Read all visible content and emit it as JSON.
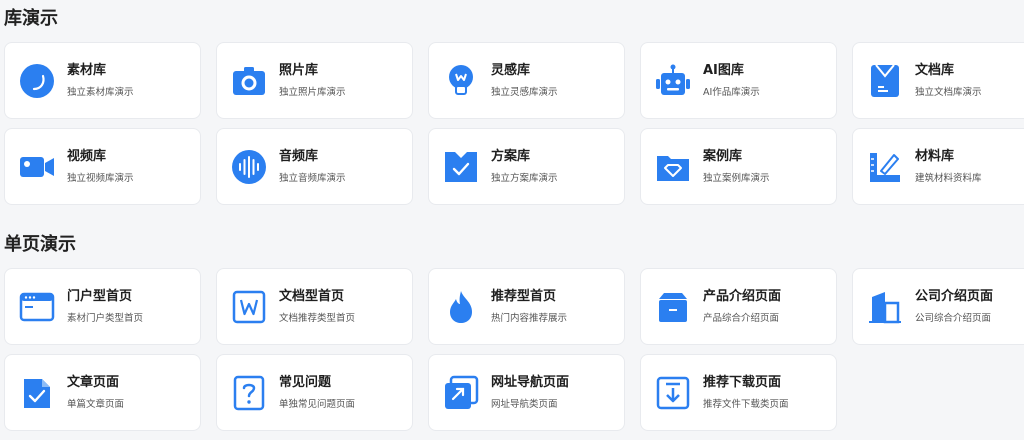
{
  "accent": "#2b7ff0",
  "sections": [
    {
      "title": "库演示",
      "cards": [
        {
          "name": "素材库",
          "desc": "独立素材库演示",
          "icon": "material-library-icon"
        },
        {
          "name": "照片库",
          "desc": "独立照片库演示",
          "icon": "camera-icon"
        },
        {
          "name": "灵感库",
          "desc": "独立灵感库演示",
          "icon": "lightbulb-icon"
        },
        {
          "name": "AI图库",
          "desc": "AI作品库演示",
          "icon": "robot-icon"
        },
        {
          "name": "文档库",
          "desc": "独立文档库演示",
          "icon": "document-icon"
        },
        {
          "name": "视频库",
          "desc": "独立视频库演示",
          "icon": "video-camera-icon"
        },
        {
          "name": "音频库",
          "desc": "独立音频库演示",
          "icon": "audio-wave-icon"
        },
        {
          "name": "方案库",
          "desc": "独立方案库演示",
          "icon": "checked-folder-icon"
        },
        {
          "name": "案例库",
          "desc": "独立案例库演示",
          "icon": "diamond-folder-icon"
        },
        {
          "name": "材料库",
          "desc": "建筑材料资料库",
          "icon": "ruler-pen-icon"
        }
      ]
    },
    {
      "title": "单页演示",
      "cards": [
        {
          "name": "门户型首页",
          "desc": "素材门户类型首页",
          "icon": "browser-window-icon"
        },
        {
          "name": "文档型首页",
          "desc": "文档推荐类型首页",
          "icon": "word-document-icon"
        },
        {
          "name": "推荐型首页",
          "desc": "热门内容推荐展示",
          "icon": "flame-icon"
        },
        {
          "name": "产品介绍页面",
          "desc": "产品综合介绍页面",
          "icon": "product-box-icon"
        },
        {
          "name": "公司介绍页面",
          "desc": "公司综合介绍页面",
          "icon": "building-icon"
        },
        {
          "name": "文章页面",
          "desc": "单篇文章页面",
          "icon": "article-check-icon"
        },
        {
          "name": "常见问题",
          "desc": "单独常见问题页面",
          "icon": "question-icon"
        },
        {
          "name": "网址导航页面",
          "desc": "网址导航类页面",
          "icon": "link-icon"
        },
        {
          "name": "推荐下载页面",
          "desc": "推荐文件下载类页面",
          "icon": "download-icon"
        }
      ]
    }
  ]
}
